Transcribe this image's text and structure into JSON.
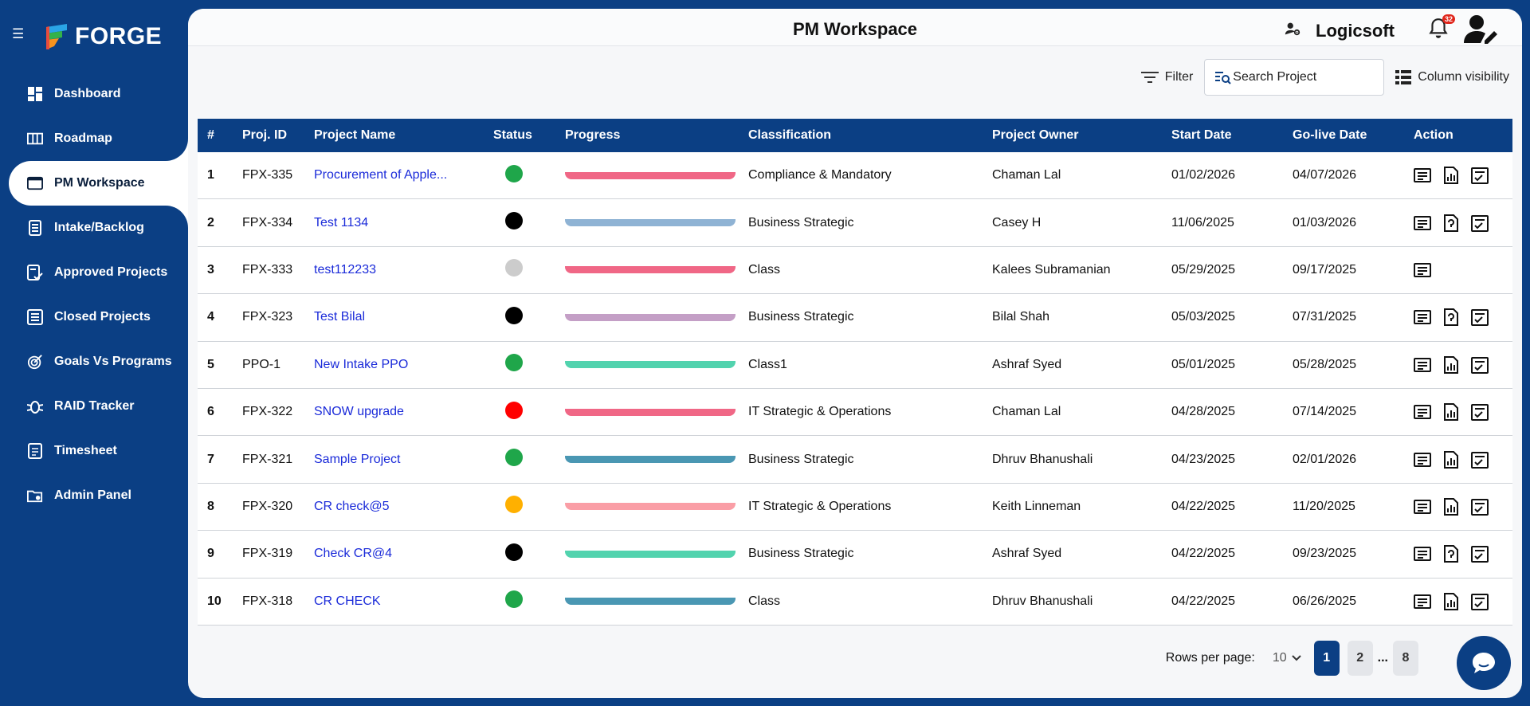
{
  "app": {
    "name": "FORGE"
  },
  "sidebar": {
    "items": [
      {
        "label": "Dashboard",
        "icon": "dashboard-icon"
      },
      {
        "label": "Roadmap",
        "icon": "roadmap-icon"
      },
      {
        "label": "PM Workspace",
        "icon": "workspace-icon",
        "active": true
      },
      {
        "label": "Intake/Backlog",
        "icon": "intake-icon"
      },
      {
        "label": "Approved Projects",
        "icon": "approved-icon"
      },
      {
        "label": "Closed Projects",
        "icon": "closed-icon"
      },
      {
        "label": "Goals Vs Programs",
        "icon": "goals-icon"
      },
      {
        "label": "RAID Tracker",
        "icon": "bug-icon"
      },
      {
        "label": "Timesheet",
        "icon": "timesheet-icon"
      },
      {
        "label": "Admin Panel",
        "icon": "admin-icon"
      }
    ]
  },
  "header": {
    "title": "PM Workspace",
    "company": "Logicsoft",
    "notification_count": "32"
  },
  "toolbar": {
    "filter_label": "Filter",
    "search_placeholder": "Search Project",
    "column_visibility_label": "Column visibility"
  },
  "table": {
    "columns": [
      "#",
      "Proj. ID",
      "Project Name",
      "Status",
      "Progress",
      "Classification",
      "Project Owner",
      "Start Date",
      "Go-live Date",
      "Action"
    ],
    "rows": [
      {
        "num": "1",
        "id": "FPX-335",
        "name": "Procurement of Apple...",
        "status_color": "#1fa64a",
        "progress_color": "#f06786",
        "classification": "Compliance & Mandatory",
        "owner": "Chaman Lal",
        "start": "01/02/2026",
        "golive": "04/07/2026",
        "actions": [
          "details-icon",
          "report-icon",
          "checklist-icon"
        ]
      },
      {
        "num": "2",
        "id": "FPX-334",
        "name": "Test 1134",
        "status_color": "#000000",
        "progress_color": "#8fb3d4",
        "classification": "Business Strategic",
        "owner": "Casey H",
        "start": "11/06/2025",
        "golive": "01/03/2026",
        "actions": [
          "details-icon",
          "document-icon",
          "checklist-icon"
        ]
      },
      {
        "num": "3",
        "id": "FPX-333",
        "name": "test112233",
        "status_color": "#cccccc",
        "progress_color": "#f06786",
        "classification": "Class",
        "owner": "Kalees Subramanian",
        "start": "05/29/2025",
        "golive": "09/17/2025",
        "actions": [
          "details-icon"
        ]
      },
      {
        "num": "4",
        "id": "FPX-323",
        "name": "Test Bilal",
        "status_color": "#000000",
        "progress_color": "#c49fc6",
        "classification": "Business Strategic",
        "owner": "Bilal Shah",
        "start": "05/03/2025",
        "golive": "07/31/2025",
        "actions": [
          "details-icon",
          "document-icon",
          "checklist-icon"
        ]
      },
      {
        "num": "5",
        "id": "PPO-1",
        "name": "New Intake PPO",
        "status_color": "#1fa64a",
        "progress_color": "#52d3ae",
        "classification": "Class1",
        "owner": "Ashraf Syed",
        "start": "05/01/2025",
        "golive": "05/28/2025",
        "actions": [
          "details-icon",
          "report-icon",
          "checklist-icon"
        ]
      },
      {
        "num": "6",
        "id": "FPX-322",
        "name": "SNOW upgrade",
        "status_color": "#ff0000",
        "progress_color": "#f06786",
        "classification": "IT Strategic & Operations",
        "owner": "Chaman Lal",
        "start": "04/28/2025",
        "golive": "07/14/2025",
        "actions": [
          "details-icon",
          "report-icon",
          "checklist-icon"
        ]
      },
      {
        "num": "7",
        "id": "FPX-321",
        "name": "Sample Project",
        "status_color": "#1fa64a",
        "progress_color": "#4a97b3",
        "classification": "Business Strategic",
        "owner": "Dhruv Bhanushali",
        "start": "04/23/2025",
        "golive": "02/01/2026",
        "actions": [
          "details-icon",
          "report-icon",
          "checklist-icon"
        ]
      },
      {
        "num": "8",
        "id": "FPX-320",
        "name": "CR check@5",
        "status_color": "#ffb000",
        "progress_color": "#fa9ea6",
        "classification": "IT Strategic & Operations",
        "owner": "Keith Linneman",
        "start": "04/22/2025",
        "golive": "11/20/2025",
        "actions": [
          "details-icon",
          "report-icon",
          "checklist-icon"
        ]
      },
      {
        "num": "9",
        "id": "FPX-319",
        "name": "Check CR@4",
        "status_color": "#000000",
        "progress_color": "#52d3ae",
        "classification": "Business Strategic",
        "owner": "Ashraf Syed",
        "start": "04/22/2025",
        "golive": "09/23/2025",
        "actions": [
          "details-icon",
          "document-icon",
          "checklist-icon"
        ]
      },
      {
        "num": "10",
        "id": "FPX-318",
        "name": "CR CHECK",
        "status_color": "#1fa64a",
        "progress_color": "#4a97b3",
        "classification": "Class",
        "owner": "Dhruv Bhanushali",
        "start": "04/22/2025",
        "golive": "06/26/2025",
        "actions": [
          "details-icon",
          "report-icon",
          "checklist-icon"
        ]
      }
    ]
  },
  "pagination": {
    "rows_per_page_label": "Rows per page:",
    "rows_per_page": "10",
    "pages": [
      "1",
      "2",
      "...",
      "8"
    ],
    "current": "1"
  },
  "colors": {
    "brand": "#0b3f84",
    "link": "#1a2ad9"
  }
}
